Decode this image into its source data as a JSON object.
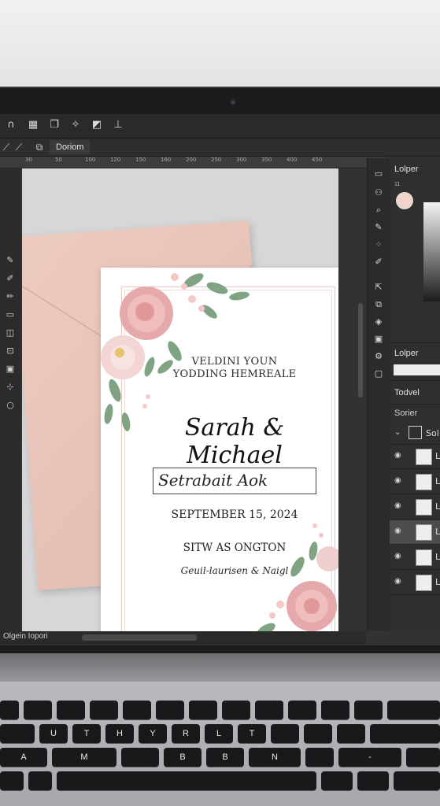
{
  "app": {
    "document_tab": "Doriom",
    "status_label": "Olgein Iopori"
  },
  "ruler_ticks": [
    "30",
    "50",
    "100",
    "120",
    "150",
    "160",
    "200",
    "250",
    "300",
    "350",
    "400",
    "450"
  ],
  "invitation": {
    "heading_line1": "VELDINI YOUN",
    "heading_line2": "YODDING HEMREALE",
    "names": "Sarah & Michael",
    "textbox_text": "Setrabait Aok",
    "date": "SEPTEMBER 15, 2024",
    "venue": "SITW AS ONGTON",
    "hosts": "Geuil-laurisen & Naigl"
  },
  "right_panel": {
    "color_title": "Lolper",
    "color_value": "11",
    "second_title": "Lolper",
    "tab_title": "Todvel",
    "layers_title": "Sorier",
    "group_label": "Sol",
    "layers": [
      {
        "label": "L",
        "selected": false
      },
      {
        "label": "L",
        "selected": false
      },
      {
        "label": "L",
        "selected": false
      },
      {
        "label": "L",
        "selected": true
      },
      {
        "label": "L",
        "selected": false
      },
      {
        "label": "L",
        "selected": false
      }
    ]
  },
  "keyboard": {
    "row1": [
      "",
      "",
      "",
      "",
      "",
      "",
      "",
      "",
      "",
      "",
      "",
      "",
      ""
    ],
    "row2": [
      "U",
      "T",
      "H",
      "Y",
      "R",
      "L",
      "T",
      "",
      ""
    ],
    "row3": [
      "A",
      "M",
      "B",
      "B",
      "N",
      "",
      "-"
    ]
  },
  "colors": {
    "accent_pink": "#e3b9ad",
    "ui_dark": "#2b2b2b"
  }
}
